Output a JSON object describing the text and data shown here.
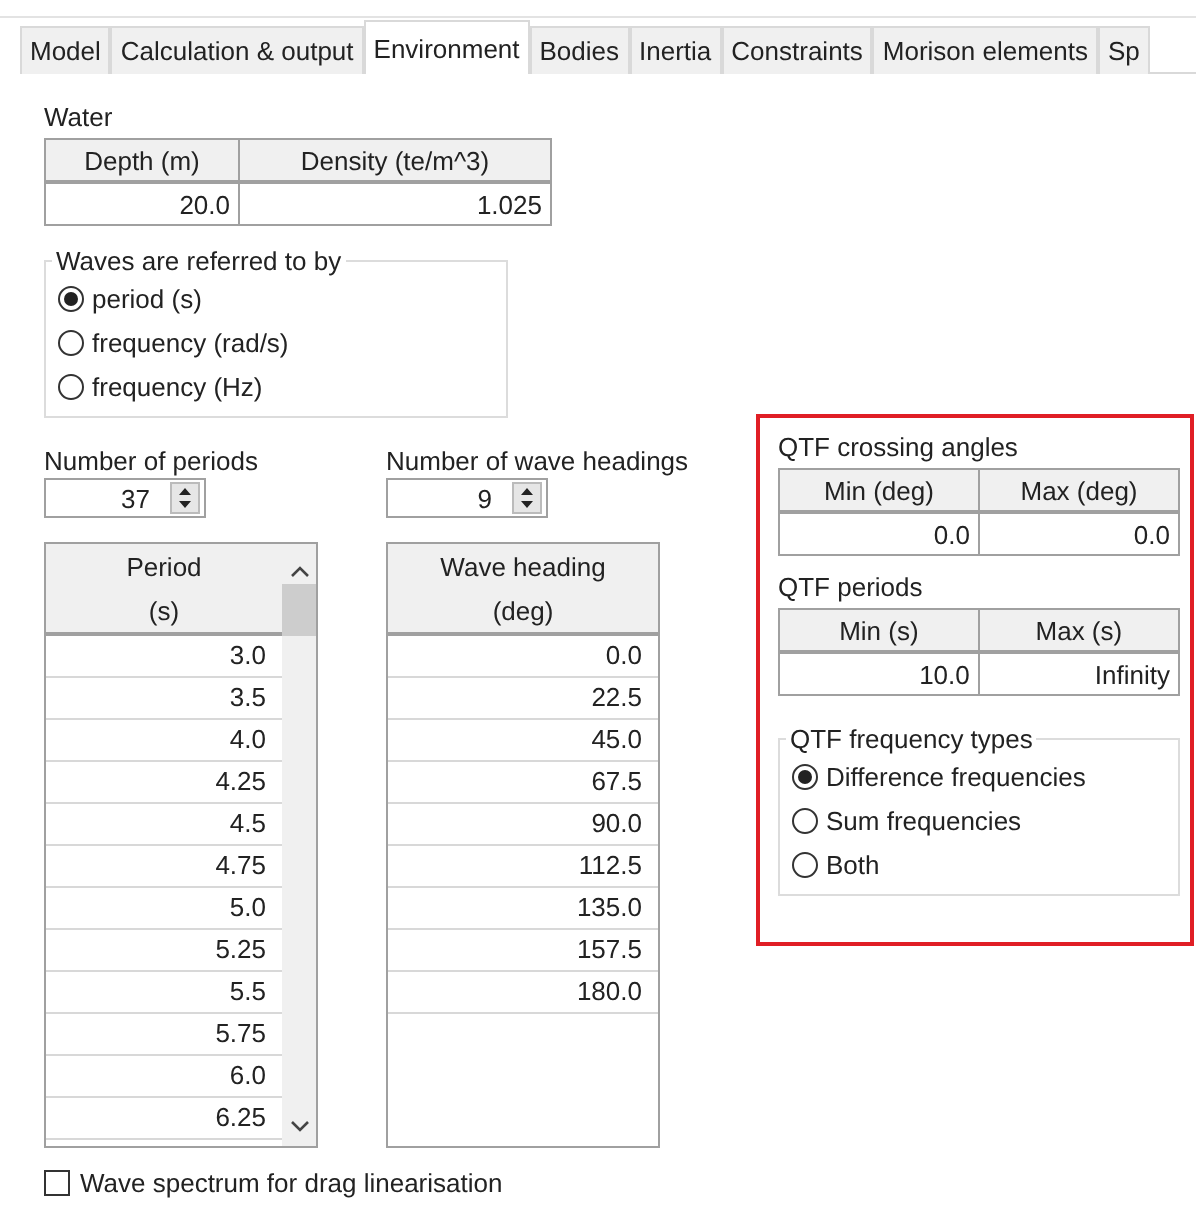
{
  "tabs": [
    {
      "label": "Model",
      "selected": false
    },
    {
      "label": "Calculation & output",
      "selected": false
    },
    {
      "label": "Environment",
      "selected": true
    },
    {
      "label": "Bodies",
      "selected": false
    },
    {
      "label": "Inertia",
      "selected": false
    },
    {
      "label": "Constraints",
      "selected": false
    },
    {
      "label": "Morison elements",
      "selected": false
    },
    {
      "label": "Sp",
      "selected": false
    }
  ],
  "water": {
    "label": "Water",
    "columns": [
      "Depth (m)",
      "Density (te/m^3)"
    ],
    "values": [
      "20.0",
      "1.025"
    ]
  },
  "waves_referred_to": {
    "title": "Waves are referred to by",
    "options": [
      {
        "label": "period (s)",
        "selected": true
      },
      {
        "label": "frequency (rad/s)",
        "selected": false
      },
      {
        "label": "frequency (Hz)",
        "selected": false
      }
    ]
  },
  "periods": {
    "label": "Number of periods",
    "count": "37",
    "header": [
      "Period",
      "(s)"
    ],
    "scrollbar": true,
    "values": [
      "3.0",
      "3.5",
      "4.0",
      "4.25",
      "4.5",
      "4.75",
      "5.0",
      "5.25",
      "5.5",
      "5.75",
      "6.0",
      "6.25"
    ]
  },
  "wave_headings": {
    "label": "Number of wave headings",
    "count": "9",
    "header": [
      "Wave heading",
      "(deg)"
    ],
    "scrollbar": false,
    "values": [
      "0.0",
      "22.5",
      "45.0",
      "67.5",
      "90.0",
      "112.5",
      "135.0",
      "157.5",
      "180.0"
    ]
  },
  "qtf": {
    "crossing_angles": {
      "label": "QTF crossing angles",
      "columns": [
        "Min (deg)",
        "Max (deg)"
      ],
      "values": [
        "0.0",
        "0.0"
      ]
    },
    "periods": {
      "label": "QTF periods",
      "columns": [
        "Min (s)",
        "Max (s)"
      ],
      "values": [
        "10.0",
        "Infinity"
      ]
    },
    "frequency_types": {
      "title": "QTF frequency types",
      "options": [
        {
          "label": "Difference frequencies",
          "selected": true
        },
        {
          "label": "Sum frequencies",
          "selected": false
        },
        {
          "label": "Both",
          "selected": false
        }
      ]
    }
  },
  "drag_linearisation": {
    "label": "Wave spectrum for drag linearisation",
    "checked": false
  }
}
